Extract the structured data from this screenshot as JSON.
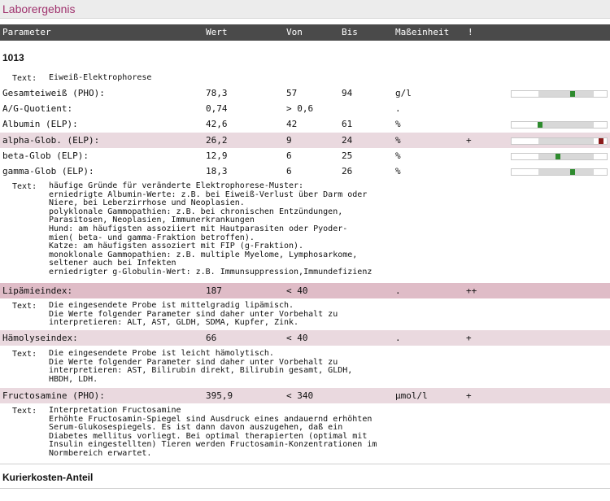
{
  "window": {
    "title": "Laborergebnis"
  },
  "columns": {
    "param": "Parameter",
    "wert": "Wert",
    "von": "Von",
    "bis": "Bis",
    "einheit": "Maßeinheit",
    "flag": "!"
  },
  "sections": {
    "s1": "1013",
    "s2": "Kurierkosten-Anteil"
  },
  "text_label": "Text:",
  "intro_text": "Eiweiß-Elektrophorese",
  "rows": {
    "r1": {
      "param": "Gesamteiweiß (PHO):",
      "wert": "78,3",
      "von": "57",
      "bis": "94",
      "einheit": "g/l",
      "flag": "",
      "level": 0.62
    },
    "r2": {
      "param": "A/G-Quotient:",
      "wert": "0,74",
      "von": "> 0,6",
      "bis": "",
      "einheit": ".",
      "flag": ""
    },
    "r3": {
      "param": "Albumin (ELP):",
      "wert": "42,6",
      "von": "42",
      "bis": "61",
      "einheit": "%",
      "flag": "",
      "level": 0.03
    },
    "r4": {
      "param": "alpha-Glob. (ELP):",
      "wert": "26,2",
      "von": "9",
      "bis": "24",
      "einheit": "%",
      "flag": "+",
      "level": 1.13
    },
    "r5": {
      "param": "beta-Glob (ELP):",
      "wert": "12,9",
      "von": "6",
      "bis": "25",
      "einheit": "%",
      "flag": "",
      "level": 0.36
    },
    "r6": {
      "param": "gamma-Glob (ELP):",
      "wert": "18,3",
      "von": "6",
      "bis": "26",
      "einheit": "%",
      "flag": "",
      "level": 0.62
    },
    "r7": {
      "param": "Lipämieindex:",
      "wert": "187",
      "von": "< 40",
      "bis": "",
      "einheit": ".",
      "flag": "++"
    },
    "r8": {
      "param": "Hämolyseindex:",
      "wert": "66",
      "von": "< 40",
      "bis": "",
      "einheit": ".",
      "flag": "+"
    },
    "r9": {
      "param": "Fructosamine (PHO):",
      "wert": "395,9",
      "von": "< 340",
      "bis": "",
      "einheit": "µmol/l",
      "flag": "+"
    }
  },
  "texts": {
    "t1": "häufige Gründe für veränderte Elektrophorese-Muster:\nerniedrigte Albumin-Werte: z.B. bei Eiweiß-Verlust über Darm oder\nNiere, bei Leberzirrhose und Neoplasien.\npolyklonale Gammopathien: z.B. bei chronischen Entzündungen,\nParasitosen, Neoplasien, Immunerkrankungen\nHund: am häufigsten assoziiert mit Hautparasiten oder Pyoder-\nmien( beta- und gamma-Fraktion betroffen).\nKatze: am häufigsten assoziert mit FIP (g-Fraktion).\nmonoklonale Gammopathien: z.B. multiple Myelome, Lymphosarkome,\nseltener auch bei Infekten\nerniedrigter g-Globulin-Wert: z.B. Immunsuppression,Immundefizienz",
    "t2": "Die eingesendete Probe ist mittelgradig lipämisch.\nDie Werte folgender Parameter sind daher unter Vorbehalt zu\ninterpretieren: ALT, AST, GLDH, SDMA, Kupfer, Zink.",
    "t3": "Die eingesendete Probe ist leicht hämolytisch.\nDie Werte folgender Parameter sind daher unter Vorbehalt zu\ninterpretieren: AST, Bilirubin direkt, Bilirubin gesamt, GLDH,\nHBDH, LDH.",
    "t4": "Interpretation Fructosamine\nErhöhte Fructosamin-Spiegel sind Ausdruck eines andauernd erhöhten\nSerum-Glukosespiegels. Es ist dann davon auszugehen, daß ein\nDiabetes mellitus vorliegt. Bei optimal therapierten (optimal mit\nInsulin eingestellten) Tieren werden Fructosamin-Konzentrationen im\nNormbereich erwartet."
  },
  "colors": {
    "accent": "#a0336e",
    "header_bg": "#4a4a4a",
    "row_highlight": "#ead9df",
    "row_highlight_strong": "#dfbcc7",
    "marker_normal": "#2e8b2e",
    "marker_high": "#8b1a1a"
  }
}
